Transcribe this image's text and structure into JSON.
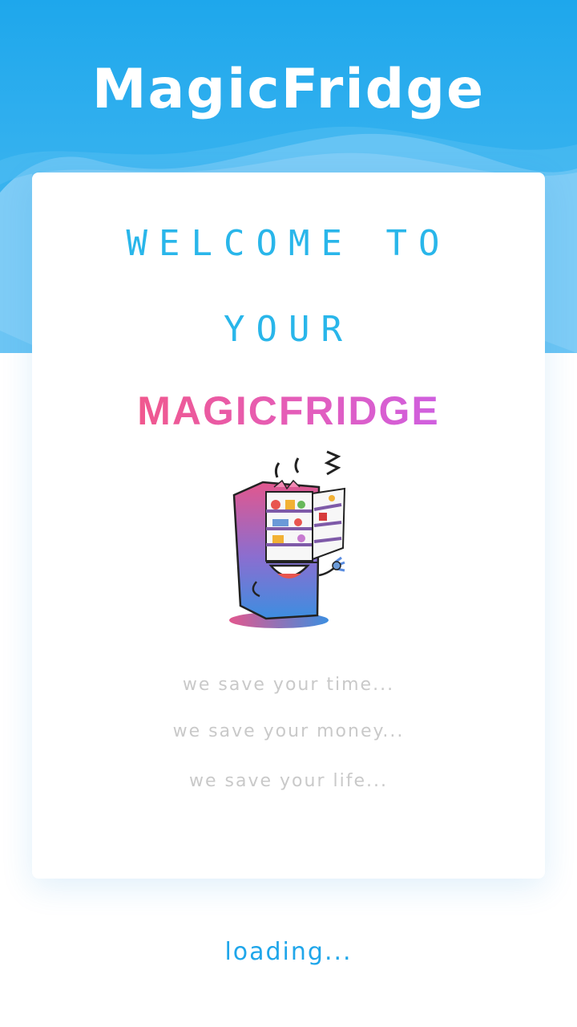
{
  "header": {
    "title": "MagicFridge"
  },
  "card": {
    "welcome_line_1": "WELCOME TO",
    "welcome_line_2": "YOUR",
    "brand": "MAGICFRIDGE",
    "illustration_icon": "cartoon-fridge-icon",
    "taglines": [
      "we save your time...",
      "we save your money...",
      "we save your life..."
    ]
  },
  "footer": {
    "status": "loading..."
  },
  "colors": {
    "header_blue": "#1ea7ec",
    "wave_light_blue": "#6cc5f4",
    "welcome_text": "#29b6ea",
    "brand_gradient_start": "#f0588e",
    "brand_gradient_end": "#cf5fe0",
    "tagline_text": "#c9c9c9",
    "loading_text": "#1fa6ea"
  }
}
